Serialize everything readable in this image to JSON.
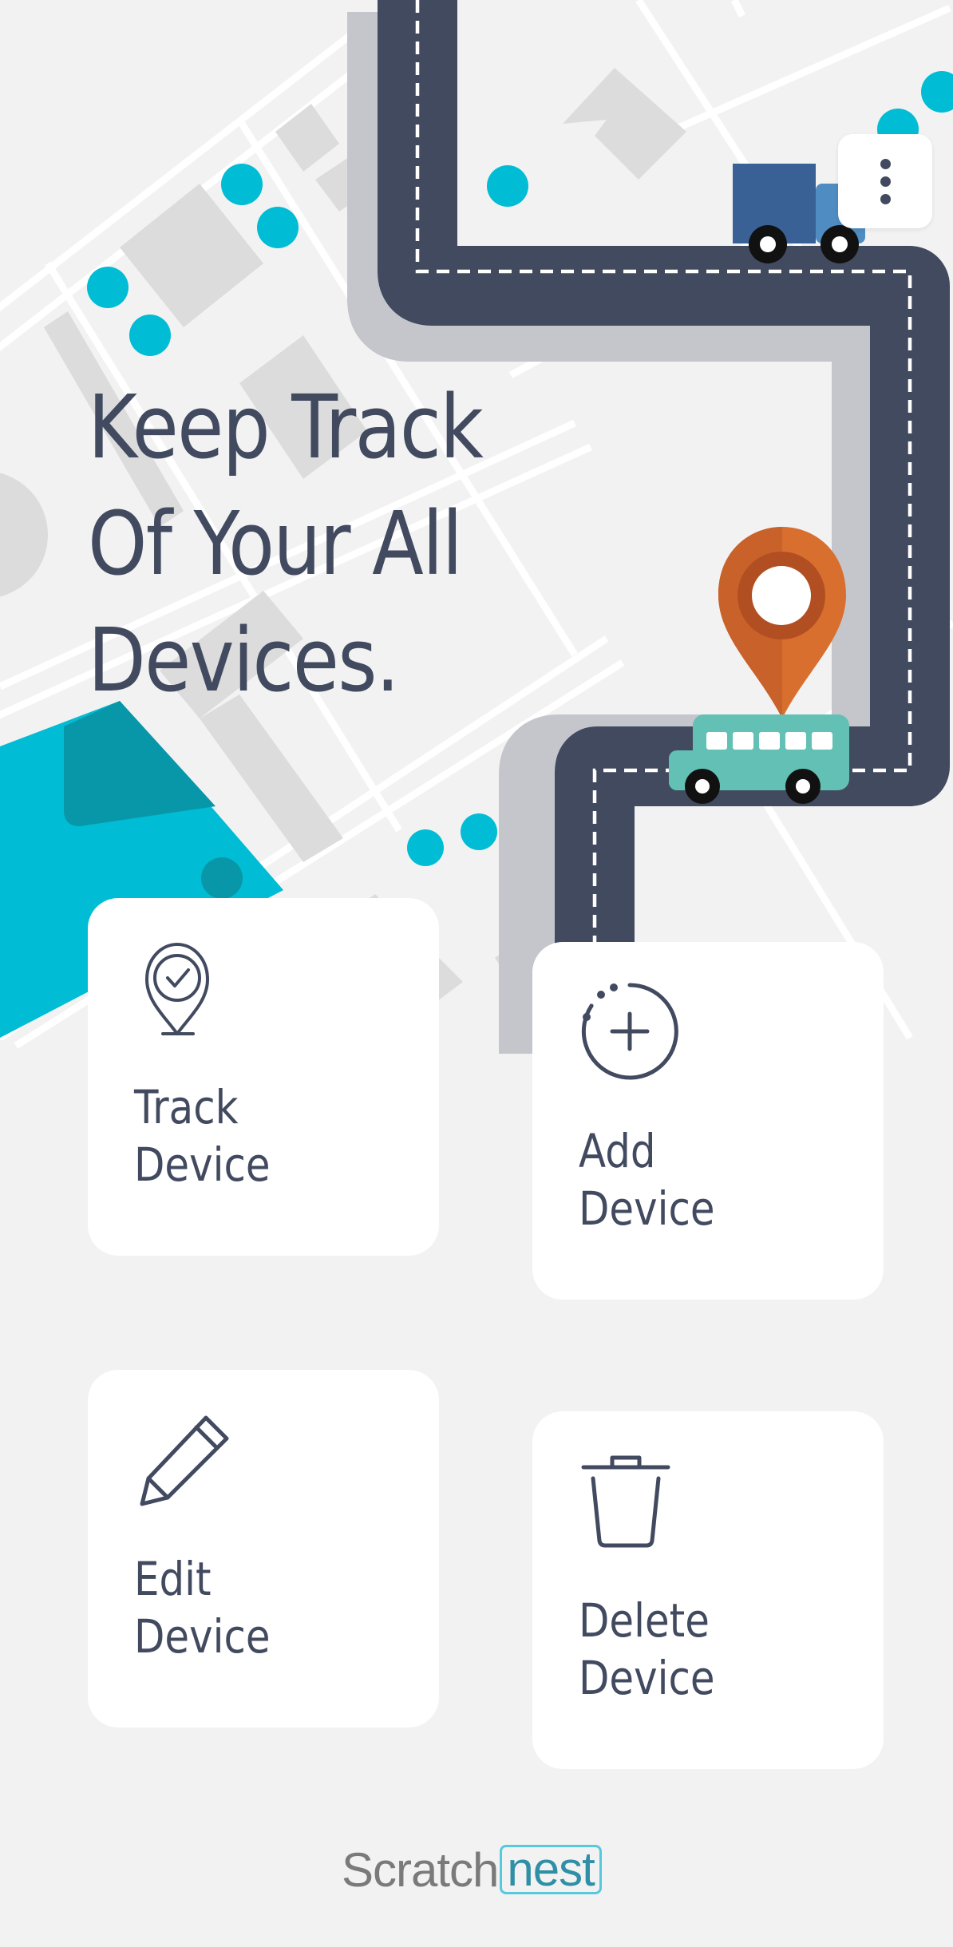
{
  "header": {
    "headline_line1": "Keep Track",
    "headline_line2": "Of Your All",
    "headline_line3": "Devices."
  },
  "menu": {
    "icon": "vertical-dots-icon"
  },
  "cards": [
    {
      "id": "track",
      "line1": "Track",
      "line2": "Device",
      "icon": "location-check-icon"
    },
    {
      "id": "add",
      "line1": "Add",
      "line2": "Device",
      "icon": "plus-circle-icon"
    },
    {
      "id": "edit",
      "line1": "Edit",
      "line2": "Device",
      "icon": "pencil-icon"
    },
    {
      "id": "delete",
      "line1": "Delete",
      "line2": "Device",
      "icon": "trash-icon"
    }
  ],
  "footer": {
    "brand_part1": "Scratch",
    "brand_part2": "nest"
  },
  "colors": {
    "background": "#f2f2f2",
    "text": "#424a60",
    "road": "#424a60",
    "accent_cyan": "#00bcd4",
    "pin_orange": "#d86f2e",
    "bus_teal": "#62c0b4",
    "truck_blue": "#3a6195"
  }
}
